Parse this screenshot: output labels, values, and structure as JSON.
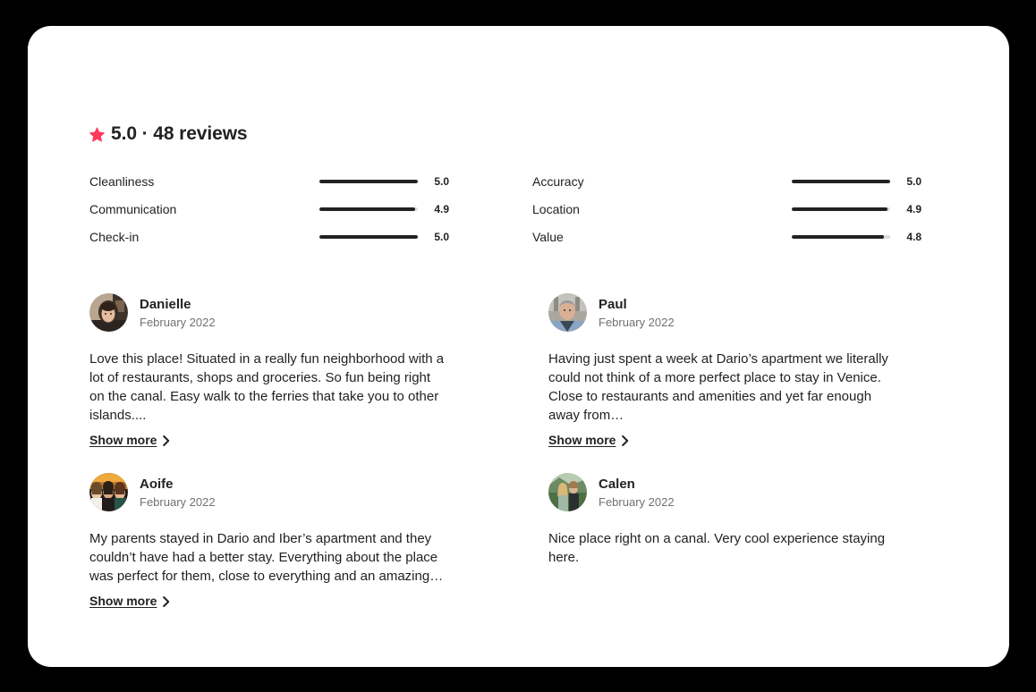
{
  "page": {
    "background_color": "#000000",
    "card_background": "#ffffff"
  },
  "header": {
    "star_icon": "star-icon",
    "accent_color": "#FF385C",
    "title": "5.0 · 48 reviews",
    "rating": "5.0",
    "review_count": "48 reviews"
  },
  "rating_categories": [
    {
      "label": "Cleanliness",
      "value": "5.0",
      "percent": 100
    },
    {
      "label": "Accuracy",
      "value": "5.0",
      "percent": 100
    },
    {
      "label": "Communication",
      "value": "4.9",
      "percent": 97
    },
    {
      "label": "Location",
      "value": "4.9",
      "percent": 97
    },
    {
      "label": "Check-in",
      "value": "5.0",
      "percent": 100
    },
    {
      "label": "Value",
      "value": "4.8",
      "percent": 94
    }
  ],
  "reviews": [
    {
      "name": "Danielle",
      "date": "February 2022",
      "avatar": "avatar-danielle",
      "text": "Love this place! Situated in a really fun neighborhood with a lot of restaurants, shops and groceries. So fun being right on the canal. Easy walk to the ferries that take you to other islands....",
      "show_more": "Show more",
      "has_show_more": true
    },
    {
      "name": "Paul",
      "date": "February 2022",
      "avatar": "avatar-paul",
      "text": "Having just spent a week at Dario’s apartment we literally could not think of a more perfect place to stay in Venice. Close to restaurants and amenities and yet far enough away from…",
      "show_more": "Show more",
      "has_show_more": true
    },
    {
      "name": "Aoife",
      "date": "February 2022",
      "avatar": "avatar-aoife",
      "text": "My parents stayed in Dario and Iber’s apartment and they couldn’t have had a better stay. Everything about the place was perfect for them, close to everything and an amazing…",
      "show_more": "Show more",
      "has_show_more": true
    },
    {
      "name": "Calen",
      "date": "February 2022",
      "avatar": "avatar-calen",
      "text": "Nice place right on a canal. Very cool experience staying here.",
      "show_more": "",
      "has_show_more": false
    }
  ]
}
